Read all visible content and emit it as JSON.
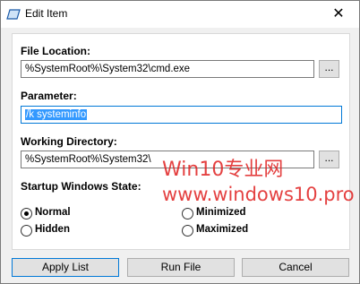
{
  "window": {
    "title": "Edit Item",
    "close_glyph": "✕"
  },
  "form": {
    "file_location": {
      "label": "File Location:",
      "value": "%SystemRoot%\\System32\\cmd.exe",
      "browse_label": "..."
    },
    "parameter": {
      "label": "Parameter:",
      "value": "/k systeminfo"
    },
    "working_directory": {
      "label": "Working Directory:",
      "value": "%SystemRoot%\\System32\\",
      "browse_label": "..."
    },
    "startup_state": {
      "label": "Startup Windows State:",
      "options": [
        {
          "label": "Normal",
          "selected": true
        },
        {
          "label": "Minimized",
          "selected": false
        },
        {
          "label": "Hidden",
          "selected": false
        },
        {
          "label": "Maximized",
          "selected": false
        }
      ]
    }
  },
  "buttons": {
    "apply": "Apply List",
    "run": "Run File",
    "cancel": "Cancel"
  },
  "watermark": {
    "line1": "Win10专业网",
    "line2": "www.windows10.pro"
  },
  "colors": {
    "accent": "#0078d7",
    "selection": "#3399ff",
    "watermark": "#e02020"
  }
}
